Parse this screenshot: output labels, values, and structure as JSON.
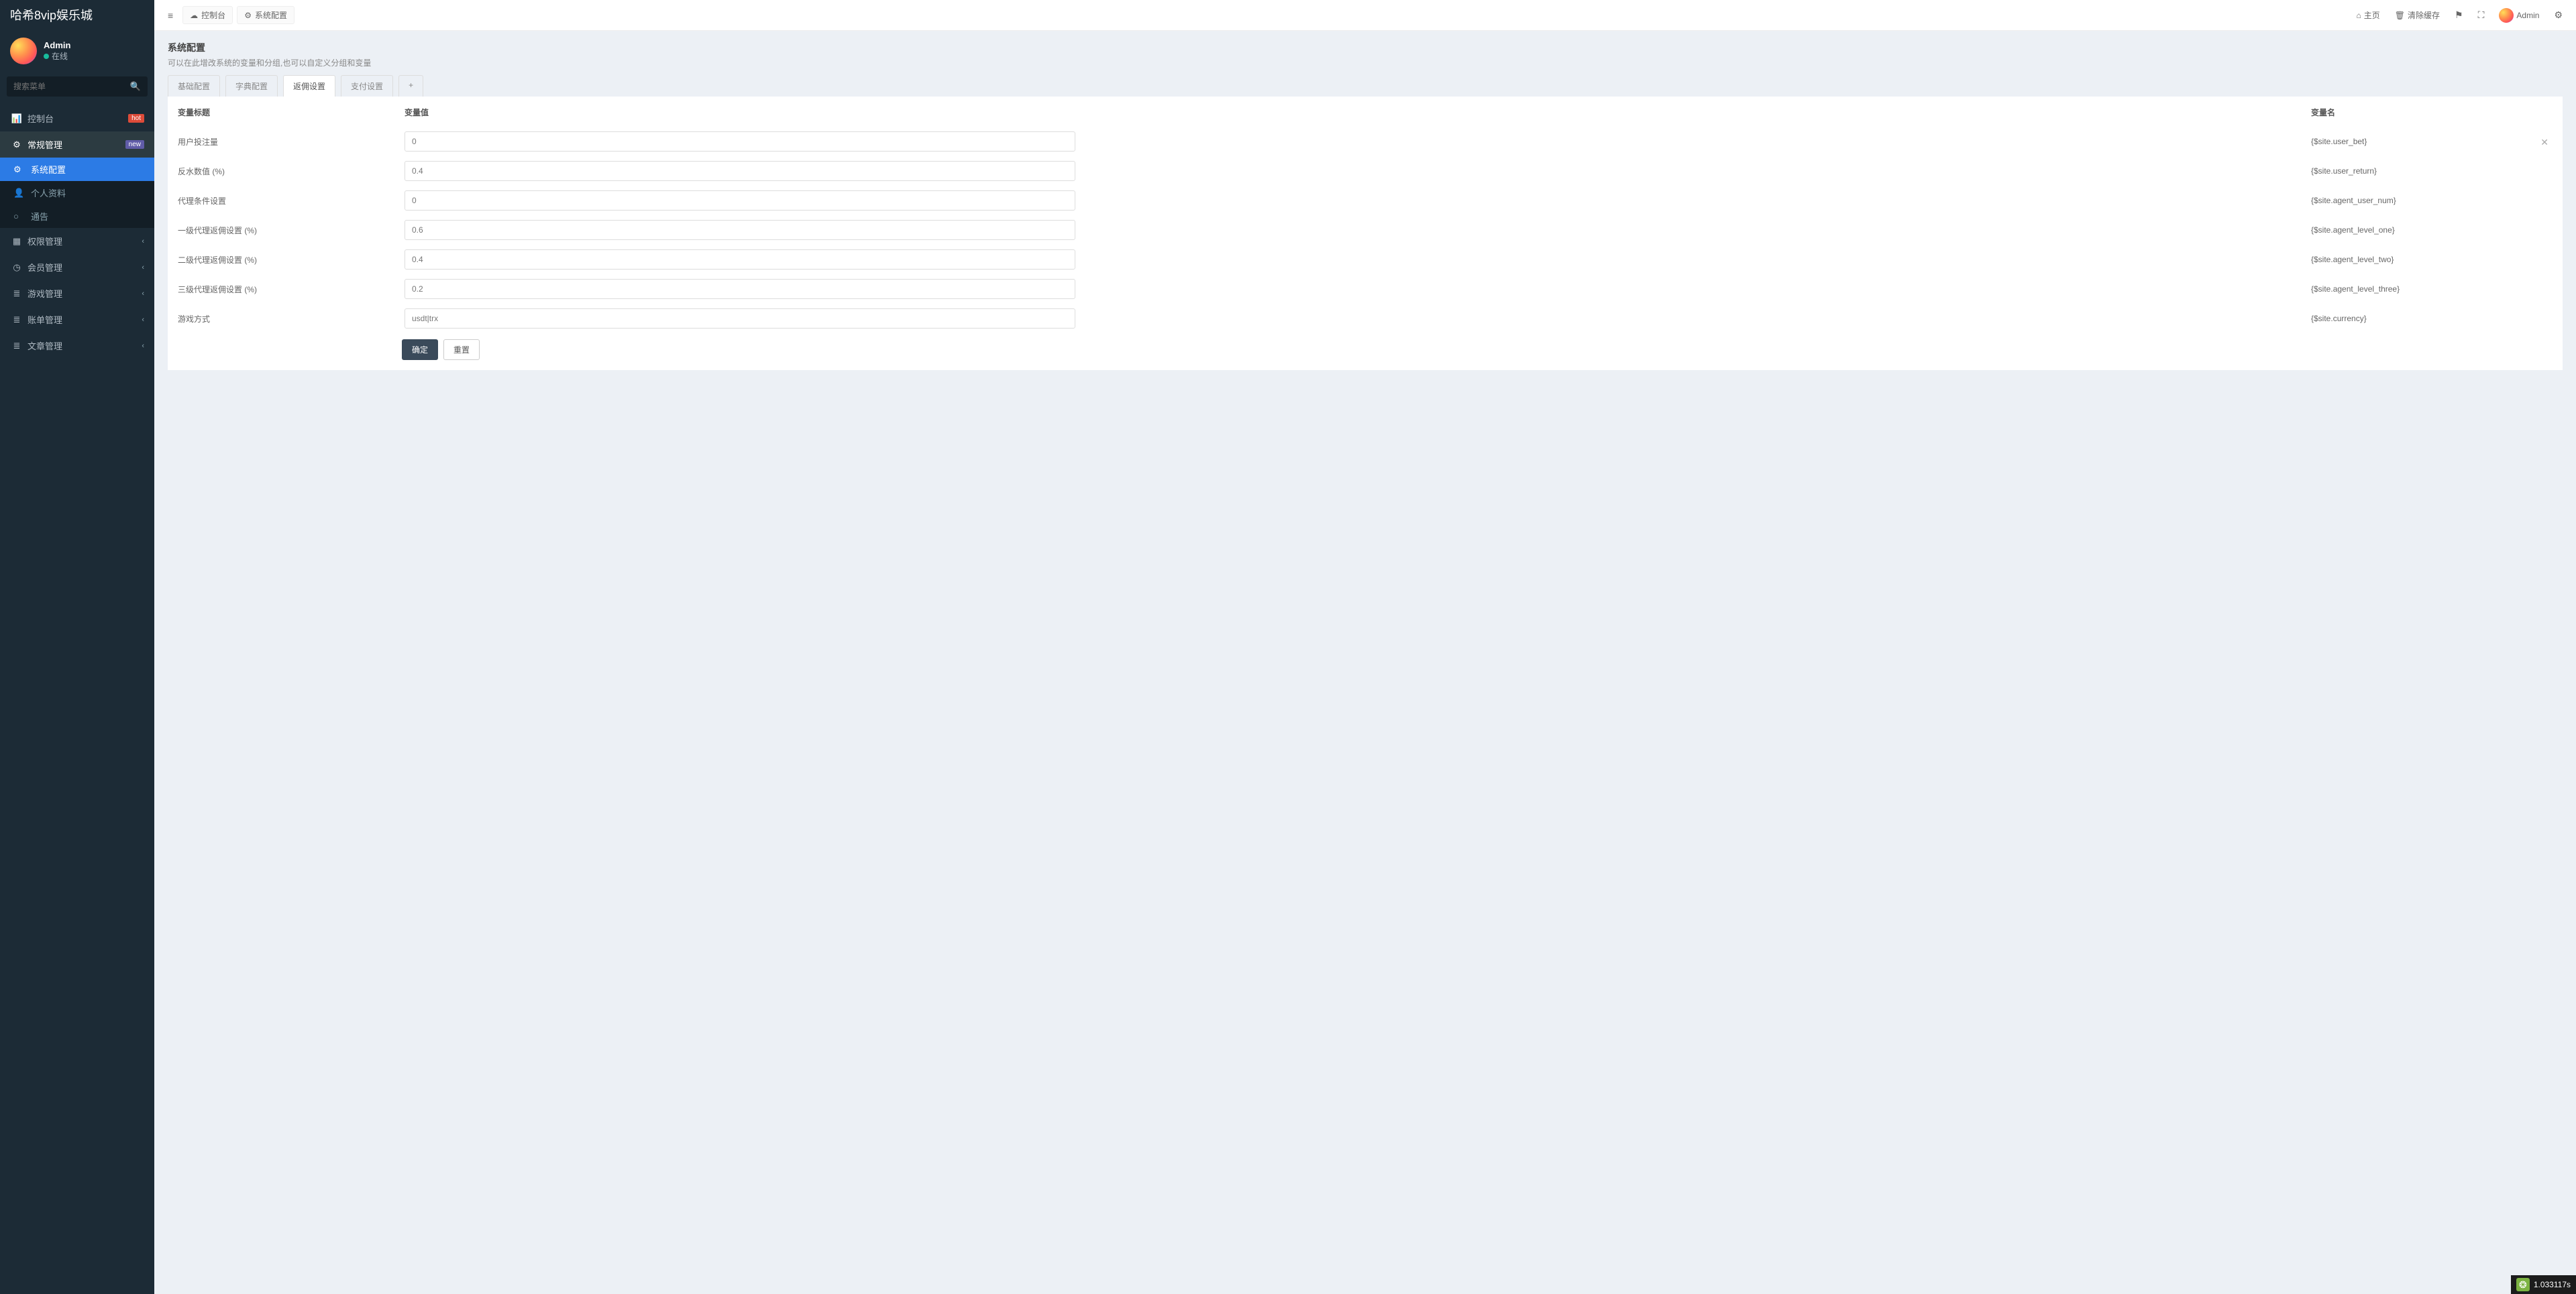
{
  "brand": "哈希8vip娱乐城",
  "user": {
    "name": "Admin",
    "status": "在线"
  },
  "search": {
    "placeholder": "搜索菜单"
  },
  "sidebar": {
    "items": [
      {
        "label": "控制台",
        "icon": "📊",
        "badge": "hot",
        "badgeClass": "badge-hot"
      },
      {
        "label": "常规管理",
        "icon": "⚙",
        "badge": "new",
        "badgeClass": "badge-new",
        "children": [
          {
            "label": "系统配置",
            "icon": "⚙",
            "selected": true
          },
          {
            "label": "个人资料",
            "icon": "👤"
          },
          {
            "label": "通告",
            "icon": "○"
          }
        ]
      },
      {
        "label": "权限管理",
        "icon": "▦",
        "caret": true
      },
      {
        "label": "会员管理",
        "icon": "◷",
        "caret": true
      },
      {
        "label": "游戏管理",
        "icon": "≣",
        "caret": true
      },
      {
        "label": "账单管理",
        "icon": "≣",
        "caret": true
      },
      {
        "label": "文章管理",
        "icon": "≣",
        "caret": true
      }
    ]
  },
  "topbar": {
    "tabs": [
      {
        "label": "控制台",
        "icon": "☁"
      },
      {
        "label": "系统配置",
        "icon": "⚙"
      }
    ],
    "links": {
      "home": "主页",
      "clear": "清除缓存"
    },
    "userName": "Admin"
  },
  "page": {
    "title": "系统配置",
    "subtitle": "可以在此增改系统的变量和分组,也可以自定义分组和变量",
    "tabs": [
      "基础配置",
      "字典配置",
      "返佣设置",
      "支付设置"
    ],
    "activeTab": 2,
    "columns": {
      "c1": "变量标题",
      "c2": "变量值",
      "c3": "变量名"
    },
    "rows": [
      {
        "title": "用户投注量",
        "value": "0",
        "var": "{$site.user_bet}",
        "close": true
      },
      {
        "title": "反水数值 (%)",
        "value": "0.4",
        "var": "{$site.user_return}"
      },
      {
        "title": "代理条件设置",
        "value": "0",
        "var": "{$site.agent_user_num}"
      },
      {
        "title": "一级代理返佣设置 (%)",
        "value": "0.6",
        "var": "{$site.agent_level_one}"
      },
      {
        "title": "二级代理返佣设置 (%)",
        "value": "0.4",
        "var": "{$site.agent_level_two}"
      },
      {
        "title": "三级代理返佣设置 (%)",
        "value": "0.2",
        "var": "{$site.agent_level_three}"
      },
      {
        "title": "游戏方式",
        "value": "usdt|trx",
        "var": "{$site.currency}"
      }
    ],
    "buttons": {
      "ok": "确定",
      "reset": "重置"
    }
  },
  "timer": "1.033117s"
}
